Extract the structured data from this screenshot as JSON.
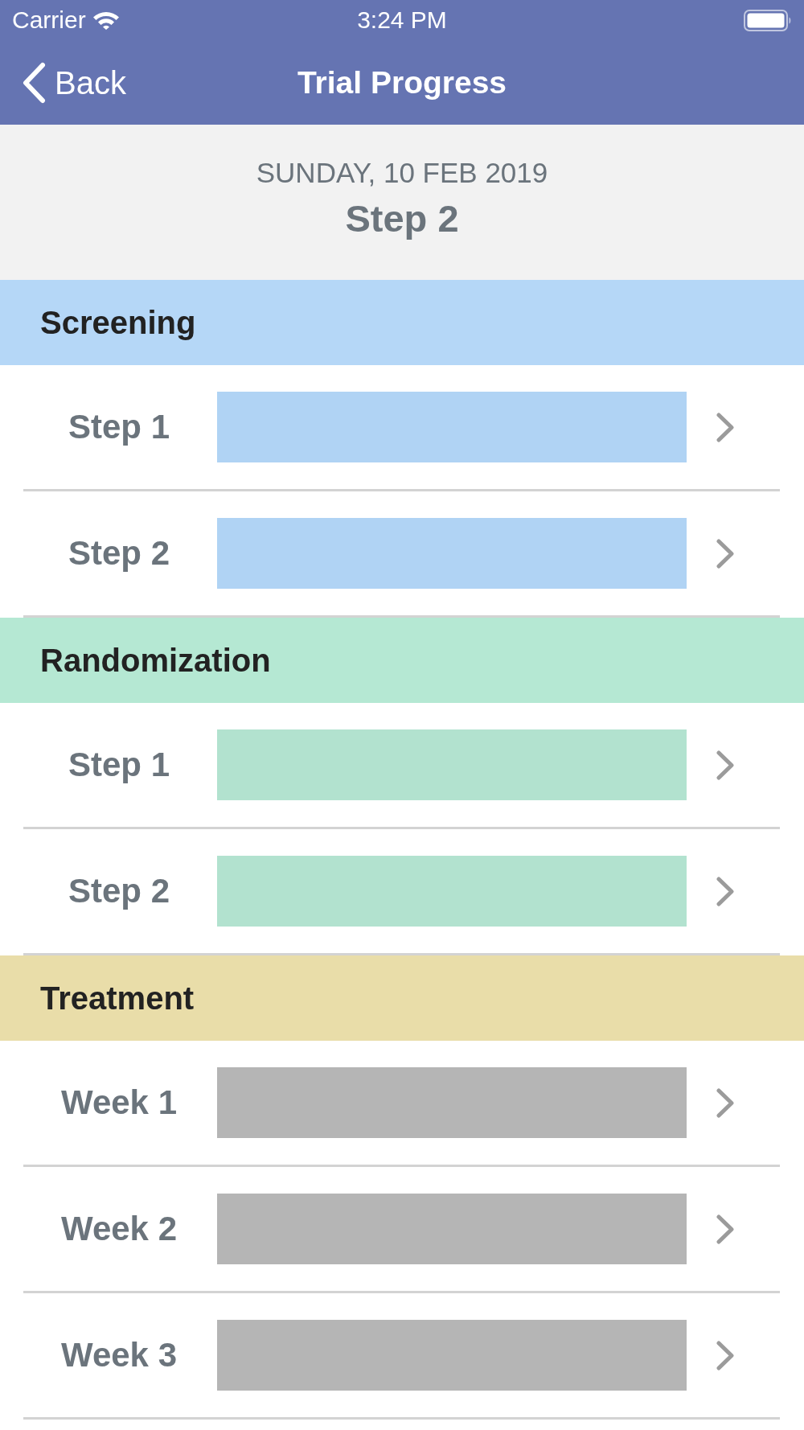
{
  "status_bar": {
    "carrier": "Carrier",
    "time": "3:24 PM"
  },
  "nav": {
    "back": "Back",
    "title": "Trial Progress"
  },
  "header": {
    "date": "SUNDAY, 10 FEB 2019",
    "current_step": "Step 2"
  },
  "sections": [
    {
      "title": "Screening",
      "color": "#b5d7f7",
      "steps": [
        {
          "label": "Step 1",
          "color": "#b0d3f4"
        },
        {
          "label": "Step 2",
          "color": "#b0d3f4"
        }
      ]
    },
    {
      "title": "Randomization",
      "color": "#b5e8d3",
      "steps": [
        {
          "label": "Step 1",
          "color": "#b2e2cf"
        },
        {
          "label": "Step 2",
          "color": "#b2e2cf"
        }
      ]
    },
    {
      "title": "Treatment",
      "color": "#e9dda9",
      "steps": [
        {
          "label": "Week 1",
          "color": "#b5b5b5"
        },
        {
          "label": "Week 2",
          "color": "#b5b5b5"
        },
        {
          "label": "Week 3",
          "color": "#b5b5b5"
        }
      ]
    }
  ]
}
